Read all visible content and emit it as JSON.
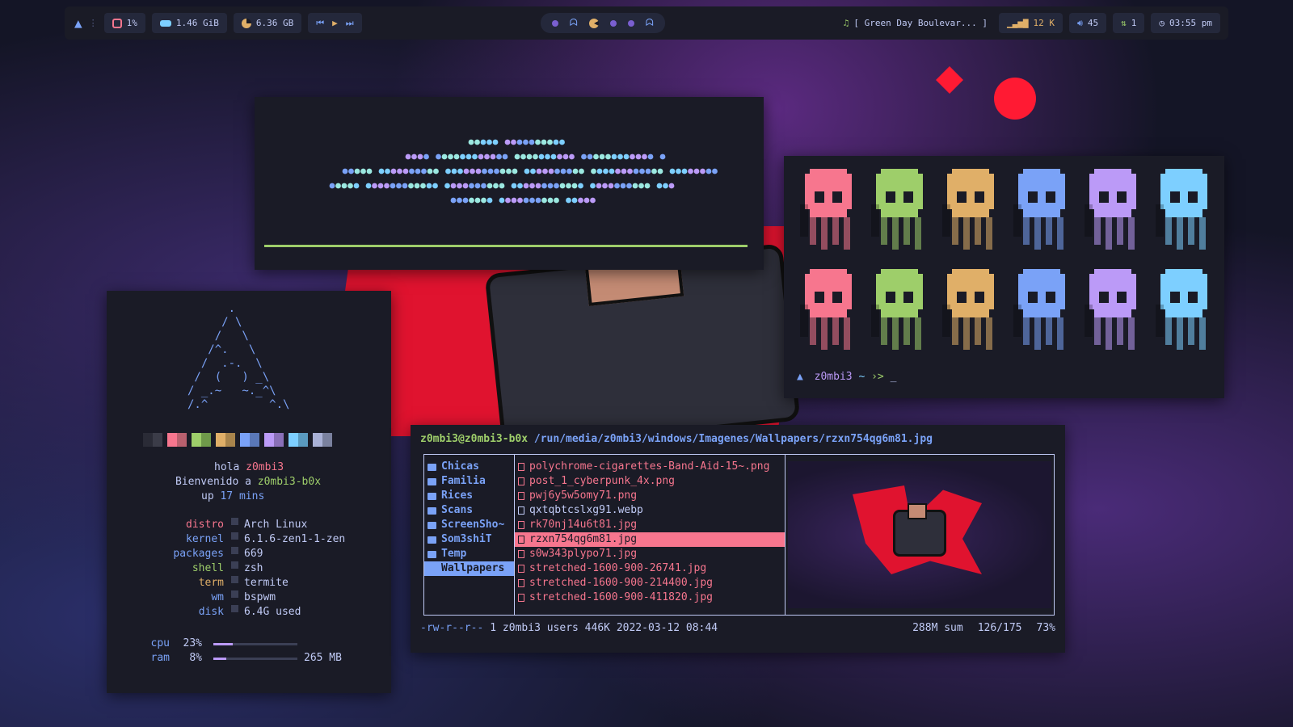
{
  "bar": {
    "cpu": "1%",
    "ram": "1.46 GiB",
    "disk": "6.36 GB",
    "now_playing": "[ Green Day Boulevar... ]",
    "network": "12 K",
    "volume": "45",
    "updates": "1",
    "clock": "03:55 pm"
  },
  "fetch": {
    "greeting_prefix": "hola",
    "user": "z0mbi3",
    "welcome_prefix": "Bienvenido a",
    "host": "z0mbi3-b0x",
    "up_prefix": "up",
    "uptime": "17 mins",
    "info": [
      {
        "key": "distro",
        "value": "Arch Linux"
      },
      {
        "key": "kernel",
        "value": "6.1.6-zen1-1-zen"
      },
      {
        "key": "packages",
        "value": "669"
      },
      {
        "key": "shell",
        "value": "zsh"
      },
      {
        "key": "term",
        "value": "termite"
      },
      {
        "key": "wm",
        "value": "bspwm"
      },
      {
        "key": "disk",
        "value": "6.4G used"
      }
    ],
    "cpu_label": "cpu",
    "cpu_value": "23%",
    "cpu_fill": 0.23,
    "ram_label": "ram",
    "ram_value": "8%",
    "ram_fill": 0.15,
    "ram_amount": "265 MB"
  },
  "terminal": {
    "prompt_user": "z0mbi3",
    "prompt_dir": "~",
    "prompt_symbol": "›>",
    "cursor": "_"
  },
  "filemanager": {
    "path_user": "z0mbi3@z0mbi3-b0x",
    "path": "/run/media/z0mbi3/windows/Imagenes/Wallpapers/rzxn754qg6m81.jpg",
    "dirs": [
      "Chicas",
      "Familia",
      "Rices",
      "Scans",
      "ScreenSho~",
      "Som3shiT",
      "Temp",
      "Wallpapers"
    ],
    "selected_dir": "Wallpapers",
    "files": [
      "polychrome-cigarettes-Band-Aid-15~.png",
      "post_1_cyberpunk_4x.png",
      "pwj6y5w5omy71.png",
      "qxtqbtcslxg91.webp",
      "rk70nj14u6t81.jpg",
      "rzxn754qg6m81.jpg",
      "s0w343plypo71.jpg",
      "stretched-1600-900-26741.jpg",
      "stretched-1600-900-214400.jpg",
      "stretched-1600-900-411820.jpg"
    ],
    "selected_file": "rzxn754qg6m81.jpg",
    "status_perms": "-rw-r--r--",
    "status_info": "1 z0mbi3 users 446K 2022-03-12 08:44",
    "status_sum": "288M sum",
    "status_pos": "126/175",
    "status_pct": "73%"
  },
  "colors": {
    "bg": "#1a1b26",
    "red": "#f7768e",
    "green": "#9ece6a",
    "yellow": "#e0af68",
    "blue": "#7aa2f7",
    "magenta": "#bb9af7",
    "cyan": "#7dcfff"
  }
}
